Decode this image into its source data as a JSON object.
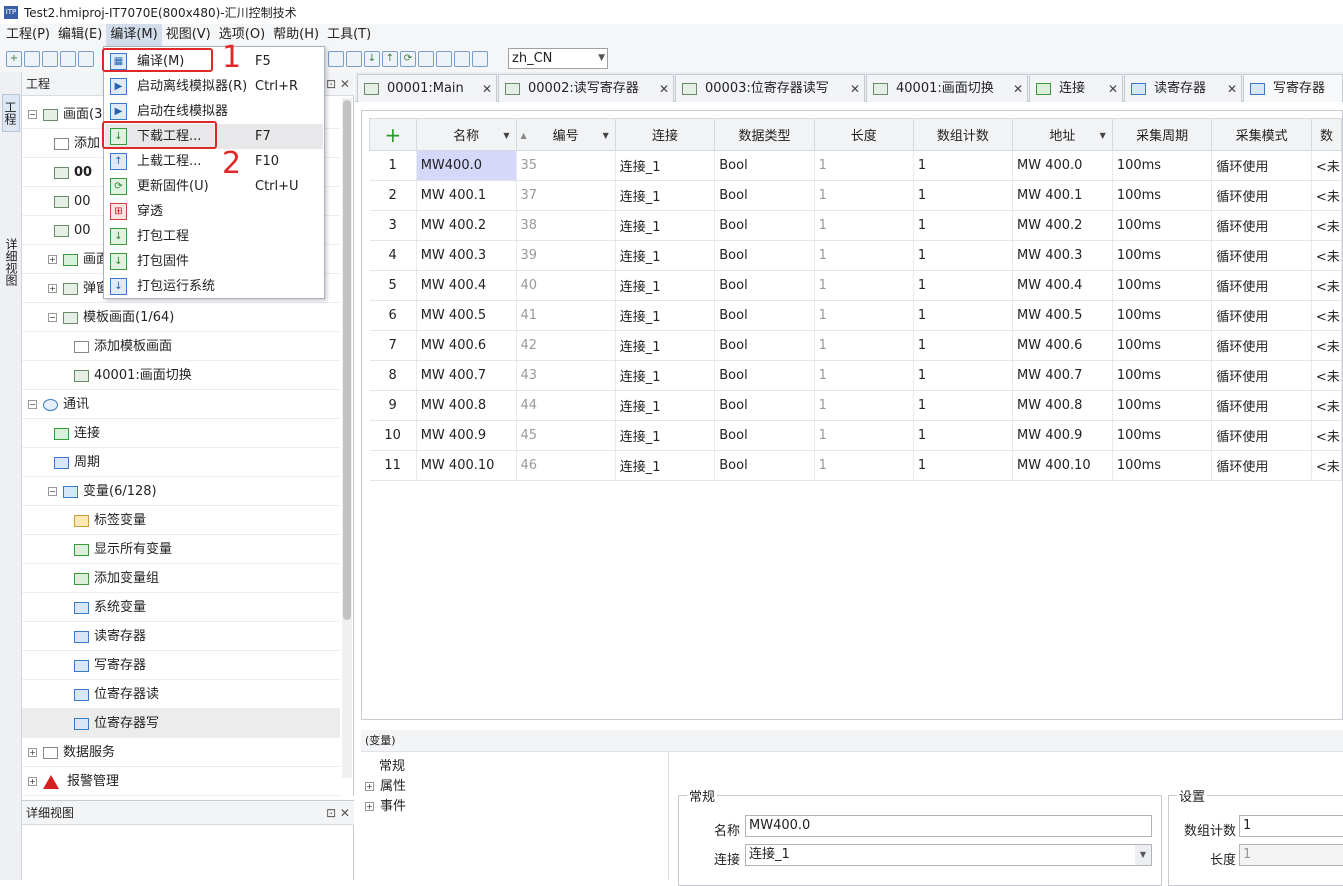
{
  "window": {
    "app_icon": "ITP",
    "title": "Test2.hmiproj-IT7070E(800x480)-汇川控制技术"
  },
  "menubar": [
    "工程(P)",
    "编辑(E)",
    "编译(M)",
    "视图(V)",
    "选项(O)",
    "帮助(H)",
    "工具(T)"
  ],
  "toolbar": {
    "language": "zh_CN"
  },
  "side_tabs": {
    "project": "工程",
    "detail": "详细视图"
  },
  "project_panel": {
    "header": "工程",
    "tree": [
      {
        "label": "画面(3",
        "expander": "−"
      },
      {
        "label": "添加",
        "expander": ""
      },
      {
        "label": "00",
        "expander": ""
      },
      {
        "label": "00",
        "expander": ""
      },
      {
        "label": "00",
        "expander": ""
      },
      {
        "label": "画面",
        "expander": "+"
      },
      {
        "label": "弹窗",
        "expander": "+"
      },
      {
        "label": "模板画面(1/64)",
        "expander": "−"
      },
      {
        "label": "添加模板画面",
        "expander": ""
      },
      {
        "label": "40001:画面切换",
        "expander": ""
      },
      {
        "label": "通讯",
        "expander": "−"
      },
      {
        "label": "连接",
        "expander": ""
      },
      {
        "label": "周期",
        "expander": ""
      },
      {
        "label": "变量(6/128)",
        "expander": "−"
      },
      {
        "label": "标签变量",
        "expander": ""
      },
      {
        "label": "显示所有变量",
        "expander": ""
      },
      {
        "label": "添加变量组",
        "expander": ""
      },
      {
        "label": "系统变量",
        "expander": ""
      },
      {
        "label": "读寄存器",
        "expander": ""
      },
      {
        "label": "写寄存器",
        "expander": ""
      },
      {
        "label": "位寄存器读",
        "expander": ""
      },
      {
        "label": "位寄存器写",
        "expander": ""
      },
      {
        "label": "数据服务",
        "expander": "+"
      },
      {
        "label": "报警管理",
        "expander": "+"
      }
    ]
  },
  "detail_panel": {
    "header": "详细视图"
  },
  "tabs": [
    {
      "label": "00001:Main"
    },
    {
      "label": "00002:读写寄存器"
    },
    {
      "label": "00003:位寄存器读写"
    },
    {
      "label": "40001:画面切换"
    },
    {
      "label": "连接"
    },
    {
      "label": "读寄存器"
    },
    {
      "label": "写寄存器"
    }
  ],
  "grid": {
    "add_button": "+",
    "columns": [
      "名称",
      "编号",
      "连接",
      "数据类型",
      "长度",
      "数组计数",
      "地址",
      "采集周期",
      "采集模式",
      "数"
    ],
    "rows": [
      {
        "n": "1",
        "name": "MW400.0",
        "id": "35",
        "conn": "连接_1",
        "type": "Bool",
        "len": "1",
        "count": "1",
        "addr": "MW 400.0",
        "cycle": "100ms",
        "mode": "循环使用",
        "extra": "<未"
      },
      {
        "n": "2",
        "name": "MW 400.1",
        "id": "37",
        "conn": "连接_1",
        "type": "Bool",
        "len": "1",
        "count": "1",
        "addr": "MW 400.1",
        "cycle": "100ms",
        "mode": "循环使用",
        "extra": "<未"
      },
      {
        "n": "3",
        "name": "MW 400.2",
        "id": "38",
        "conn": "连接_1",
        "type": "Bool",
        "len": "1",
        "count": "1",
        "addr": "MW 400.2",
        "cycle": "100ms",
        "mode": "循环使用",
        "extra": "<未"
      },
      {
        "n": "4",
        "name": "MW 400.3",
        "id": "39",
        "conn": "连接_1",
        "type": "Bool",
        "len": "1",
        "count": "1",
        "addr": "MW 400.3",
        "cycle": "100ms",
        "mode": "循环使用",
        "extra": "<未"
      },
      {
        "n": "5",
        "name": "MW 400.4",
        "id": "40",
        "conn": "连接_1",
        "type": "Bool",
        "len": "1",
        "count": "1",
        "addr": "MW 400.4",
        "cycle": "100ms",
        "mode": "循环使用",
        "extra": "<未"
      },
      {
        "n": "6",
        "name": "MW 400.5",
        "id": "41",
        "conn": "连接_1",
        "type": "Bool",
        "len": "1",
        "count": "1",
        "addr": "MW 400.5",
        "cycle": "100ms",
        "mode": "循环使用",
        "extra": "<未"
      },
      {
        "n": "7",
        "name": "MW 400.6",
        "id": "42",
        "conn": "连接_1",
        "type": "Bool",
        "len": "1",
        "count": "1",
        "addr": "MW 400.6",
        "cycle": "100ms",
        "mode": "循环使用",
        "extra": "<未"
      },
      {
        "n": "8",
        "name": "MW 400.7",
        "id": "43",
        "conn": "连接_1",
        "type": "Bool",
        "len": "1",
        "count": "1",
        "addr": "MW 400.7",
        "cycle": "100ms",
        "mode": "循环使用",
        "extra": "<未"
      },
      {
        "n": "9",
        "name": "MW 400.8",
        "id": "44",
        "conn": "连接_1",
        "type": "Bool",
        "len": "1",
        "count": "1",
        "addr": "MW 400.8",
        "cycle": "100ms",
        "mode": "循环使用",
        "extra": "<未"
      },
      {
        "n": "10",
        "name": "MW 400.9",
        "id": "45",
        "conn": "连接_1",
        "type": "Bool",
        "len": "1",
        "count": "1",
        "addr": "MW 400.9",
        "cycle": "100ms",
        "mode": "循环使用",
        "extra": "<未"
      },
      {
        "n": "11",
        "name": "MW 400.10",
        "id": "46",
        "conn": "连接_1",
        "type": "Bool",
        "len": "1",
        "count": "1",
        "addr": "MW 400.10",
        "cycle": "100ms",
        "mode": "循环使用",
        "extra": "<未"
      }
    ]
  },
  "properties": {
    "header": "(变量)",
    "tree": [
      {
        "label": "常规",
        "expander": ""
      },
      {
        "label": "属性",
        "expander": "+"
      },
      {
        "label": "事件",
        "expander": "+"
      }
    ],
    "general": {
      "legend": "常规",
      "name_label": "名称",
      "name_value": "MW400.0",
      "conn_label": "连接",
      "conn_value": "连接_1"
    },
    "settings": {
      "legend": "设置",
      "count_label": "数组计数",
      "count_value": "1",
      "length_label": "长度",
      "length_value": "1"
    }
  },
  "compile_menu": [
    {
      "label": "编译(M)",
      "key": "F5",
      "icon": "compile-icon"
    },
    {
      "label": "启动离线模拟器(R)",
      "key": "Ctrl+R",
      "icon": "offline-simulator-icon"
    },
    {
      "label": "启动在线模拟器",
      "key": "",
      "icon": "online-simulator-icon"
    },
    {
      "label": "下载工程...",
      "key": "F7",
      "icon": "download-icon"
    },
    {
      "label": "上载工程...",
      "key": "F10",
      "icon": "upload-icon"
    },
    {
      "label": "更新固件(U)",
      "key": "Ctrl+U",
      "icon": "update-firmware-icon"
    },
    {
      "label": "穿透",
      "key": "",
      "icon": "passthrough-icon"
    },
    {
      "label": "打包工程",
      "key": "",
      "icon": "package-project-icon"
    },
    {
      "label": "打包固件",
      "key": "",
      "icon": "package-firmware-icon"
    },
    {
      "label": "打包运行系统",
      "key": "",
      "icon": "package-runtime-icon"
    }
  ],
  "annotations": {
    "step1": "1",
    "step2": "2",
    "color": "#e02828"
  }
}
